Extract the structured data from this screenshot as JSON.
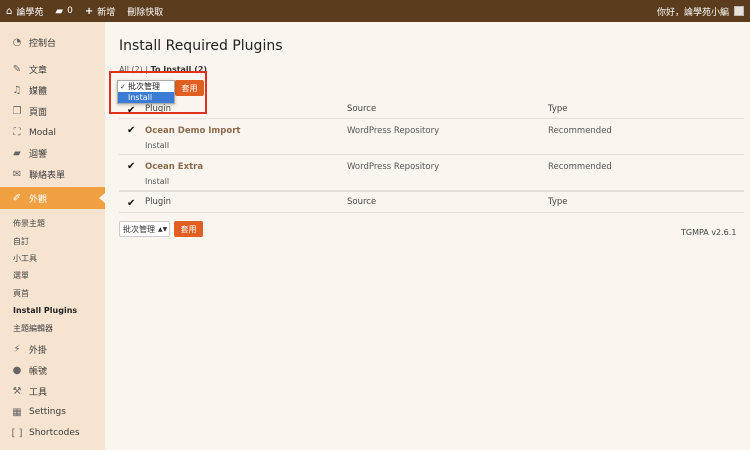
{
  "adminbar": {
    "site_name": "論學苑",
    "comments_count": "0",
    "new_label": "新增",
    "cache_label": "刪除快取",
    "greeting": "你好，論學苑小編"
  },
  "sidebar": {
    "items": [
      {
        "label": "控制台",
        "icon": "dashboard-icon"
      },
      {
        "label": "文章",
        "icon": "pin-icon"
      },
      {
        "label": "媒體",
        "icon": "media-icon"
      },
      {
        "label": "頁面",
        "icon": "pages-icon"
      },
      {
        "label": "Modal",
        "icon": "modal-icon"
      },
      {
        "label": "迴響",
        "icon": "comment-icon"
      },
      {
        "label": "聯絡表單",
        "icon": "mail-icon"
      },
      {
        "label": "外觀",
        "icon": "brush-icon"
      },
      {
        "label": "外掛",
        "icon": "plug-icon"
      },
      {
        "label": "帳號",
        "icon": "user-icon"
      },
      {
        "label": "工具",
        "icon": "wrench-icon"
      },
      {
        "label": "Settings",
        "icon": "settings-icon"
      },
      {
        "label": "Shortcodes",
        "icon": "shortcode-icon"
      }
    ],
    "submenu": [
      "佈景主題",
      "自訂",
      "小工具",
      "選單",
      "頁首",
      "Install Plugins",
      "主題編輯器"
    ]
  },
  "main": {
    "title": "Install Required Plugins",
    "filter_all": "All (2)",
    "filter_sep": "|",
    "filter_install": "To Install (2)",
    "columns": {
      "plugin": "Plugin",
      "source": "Source",
      "type": "Type"
    },
    "rows": [
      {
        "name": "Ocean Demo Import",
        "action": "Install",
        "source": "WordPress Repository",
        "type": "Recommended"
      },
      {
        "name": "Ocean Extra",
        "action": "Install",
        "source": "WordPress Repository",
        "type": "Recommended"
      }
    ],
    "bulk_options": [
      "批次管理",
      "Install"
    ],
    "bulk_selected": "批次管理",
    "apply_label": "套用",
    "version": "TGMPA v2.6.1"
  },
  "colors": {
    "adminbar": "#5b3c1c",
    "accent": "#e25f22",
    "active_menu": "#f0a040",
    "highlight": "#e03020"
  }
}
